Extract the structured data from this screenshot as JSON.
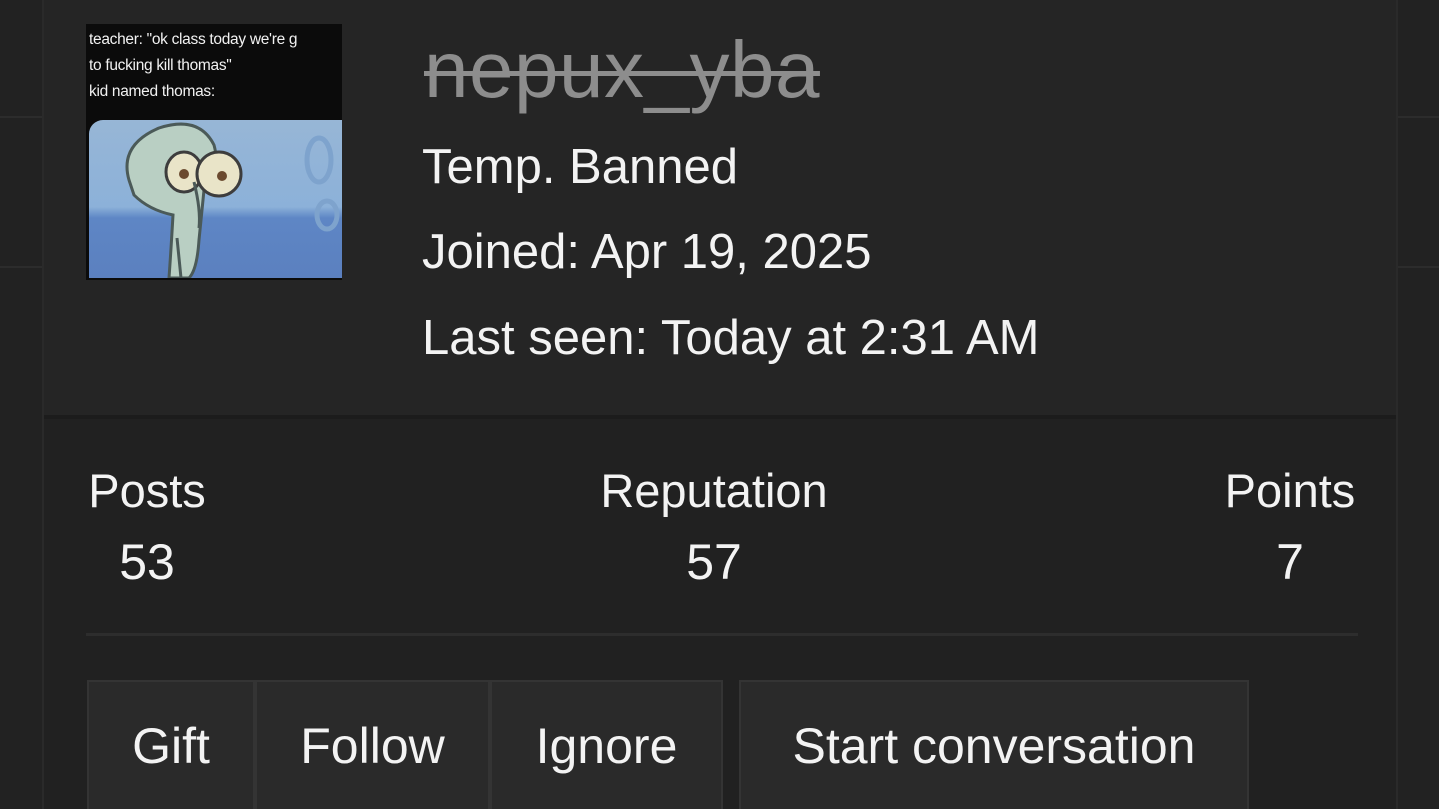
{
  "profile": {
    "username": "nepux_yba",
    "status": "Temp. Banned",
    "joined": "Joined: Apr 19, 2025",
    "last_seen": "Last seen: Today at 2:31 AM",
    "avatar_caption": "teacher: \"ok class today we're g\nto fucking kill thomas\"\nkid named thomas:"
  },
  "stats": {
    "posts": {
      "label": "Posts",
      "value": "53"
    },
    "reputation": {
      "label": "Reputation",
      "value": "57"
    },
    "points": {
      "label": "Points",
      "value": "7"
    }
  },
  "actions": {
    "gift": "Gift",
    "follow": "Follow",
    "ignore": "Ignore",
    "start_conversation": "Start conversation"
  },
  "colors": {
    "background": "#1b1b1b",
    "card": "#212121",
    "header": "#252525",
    "button": "#2a2a2a",
    "banned_username": "#8d8d8d",
    "text": "#f3f3f3"
  }
}
